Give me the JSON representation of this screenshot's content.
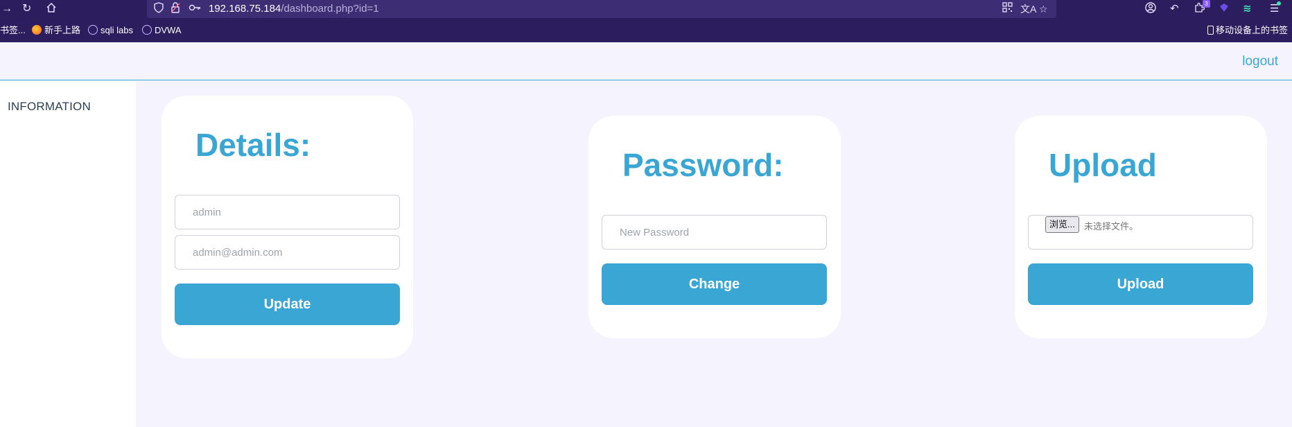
{
  "browser": {
    "url_host": "192.168.75.184",
    "url_path": "/dashboard.php?id=1",
    "extension_badge": "3",
    "bookmarks": [
      {
        "label": "书签..."
      },
      {
        "label": "新手上路"
      },
      {
        "label": "sqli labs"
      },
      {
        "label": "DVWA"
      }
    ],
    "mobile_bookmarks": "移动设备上的书签"
  },
  "header": {
    "logout_label": "logout"
  },
  "sidebar": {
    "items": [
      {
        "label": "INFORMATION"
      }
    ]
  },
  "details": {
    "title": "Details:",
    "username_placeholder": "admin",
    "email_placeholder": "admin@admin.com",
    "button_label": "Update"
  },
  "password": {
    "title": "Password:",
    "new_password_placeholder": "New Password",
    "button_label": "Change"
  },
  "upload": {
    "title": "Upload",
    "browse_label": "浏览...",
    "file_status": "未选择文件。",
    "button_label": "Upload"
  },
  "colors": {
    "accent": "#3aa6d4",
    "browser_chrome": "#2b1d5e",
    "page_background": "#f5f4fe",
    "card_background": "#ffffff"
  }
}
